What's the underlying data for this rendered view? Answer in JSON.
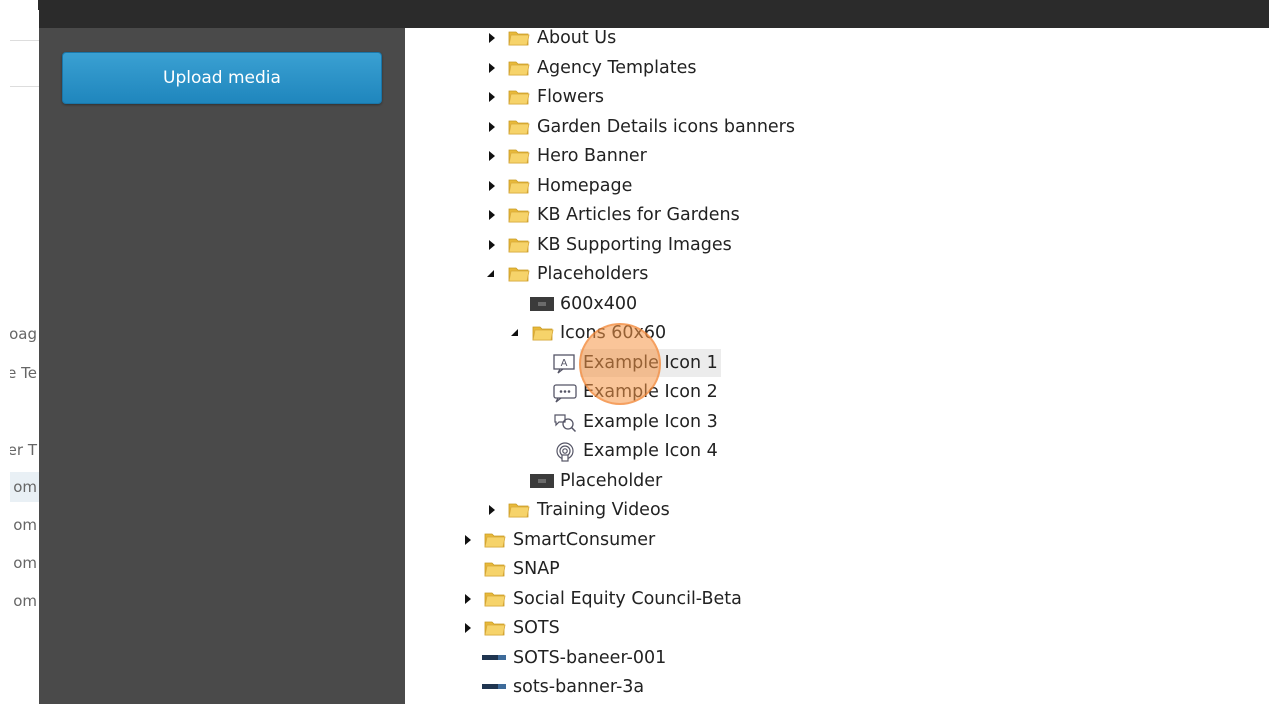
{
  "background_page": {
    "items": [
      "oag",
      "e Te",
      "er T",
      "om",
      "om",
      "om",
      "om"
    ]
  },
  "sidebar": {
    "upload_label": "Upload media",
    "button_color": "#2b93c8"
  },
  "tree": {
    "items": [
      {
        "label": "About Us",
        "type": "folder",
        "state": "collapsed"
      },
      {
        "label": "Agency Templates",
        "type": "folder",
        "state": "collapsed"
      },
      {
        "label": "Flowers",
        "type": "folder",
        "state": "collapsed"
      },
      {
        "label": "Garden Details icons banners",
        "type": "folder",
        "state": "collapsed"
      },
      {
        "label": "Hero Banner",
        "type": "folder",
        "state": "collapsed"
      },
      {
        "label": "Homepage",
        "type": "folder",
        "state": "collapsed"
      },
      {
        "label": "KB Articles for Gardens",
        "type": "folder",
        "state": "collapsed"
      },
      {
        "label": "KB Supporting Images",
        "type": "folder",
        "state": "collapsed"
      },
      {
        "label": "Placeholders",
        "type": "folder",
        "state": "expanded"
      },
      {
        "label": "600x400",
        "type": "image"
      },
      {
        "label": "Icons 60x60",
        "type": "folder",
        "state": "expanded"
      },
      {
        "label": "Example Icon 1",
        "type": "icon",
        "icon": "text-box-icon",
        "selected": true
      },
      {
        "label": "Example Icon 2",
        "type": "icon",
        "icon": "chat-bubble-icon"
      },
      {
        "label": "Example Icon 3",
        "type": "icon",
        "icon": "chat-search-icon"
      },
      {
        "label": "Example Icon 4",
        "type": "icon",
        "icon": "broadcast-icon"
      },
      {
        "label": "Placeholder",
        "type": "image"
      },
      {
        "label": "Training Videos",
        "type": "folder",
        "state": "collapsed"
      },
      {
        "label": "SmartConsumer",
        "type": "folder",
        "state": "collapsed"
      },
      {
        "label": "SNAP",
        "type": "folder",
        "state": "none"
      },
      {
        "label": "Social Equity Council-Beta",
        "type": "folder",
        "state": "collapsed"
      },
      {
        "label": "SOTS",
        "type": "folder",
        "state": "collapsed"
      },
      {
        "label": "SOTS-baneer-001",
        "type": "banner-image"
      },
      {
        "label": "sots-banner-3a",
        "type": "banner-image"
      }
    ]
  },
  "colors": {
    "topbar": "#2b2b2b",
    "sidebar": "#4a4a4a",
    "folder": "#f2c94c",
    "click_highlight": "#f5964a"
  }
}
